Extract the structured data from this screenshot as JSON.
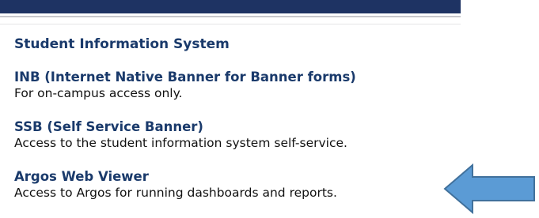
{
  "section": {
    "title": "Student Information System"
  },
  "entries": [
    {
      "link": "INB (Internet Native Banner for Banner forms)",
      "description": "For on-campus access only."
    },
    {
      "link": "SSB (Self Service Banner)",
      "description": "Access to the student information system self-service."
    },
    {
      "link": "Argos Web Viewer",
      "description": "Access to Argos for running dashboards and reports."
    }
  ],
  "colors": {
    "header_bar": "#1e3363",
    "link": "#1a3a6b",
    "arrow_fill": "#5b9bd5",
    "arrow_stroke": "#41719c"
  },
  "annotation": {
    "icon": "left-arrow-icon",
    "points_to": "Argos Web Viewer"
  }
}
